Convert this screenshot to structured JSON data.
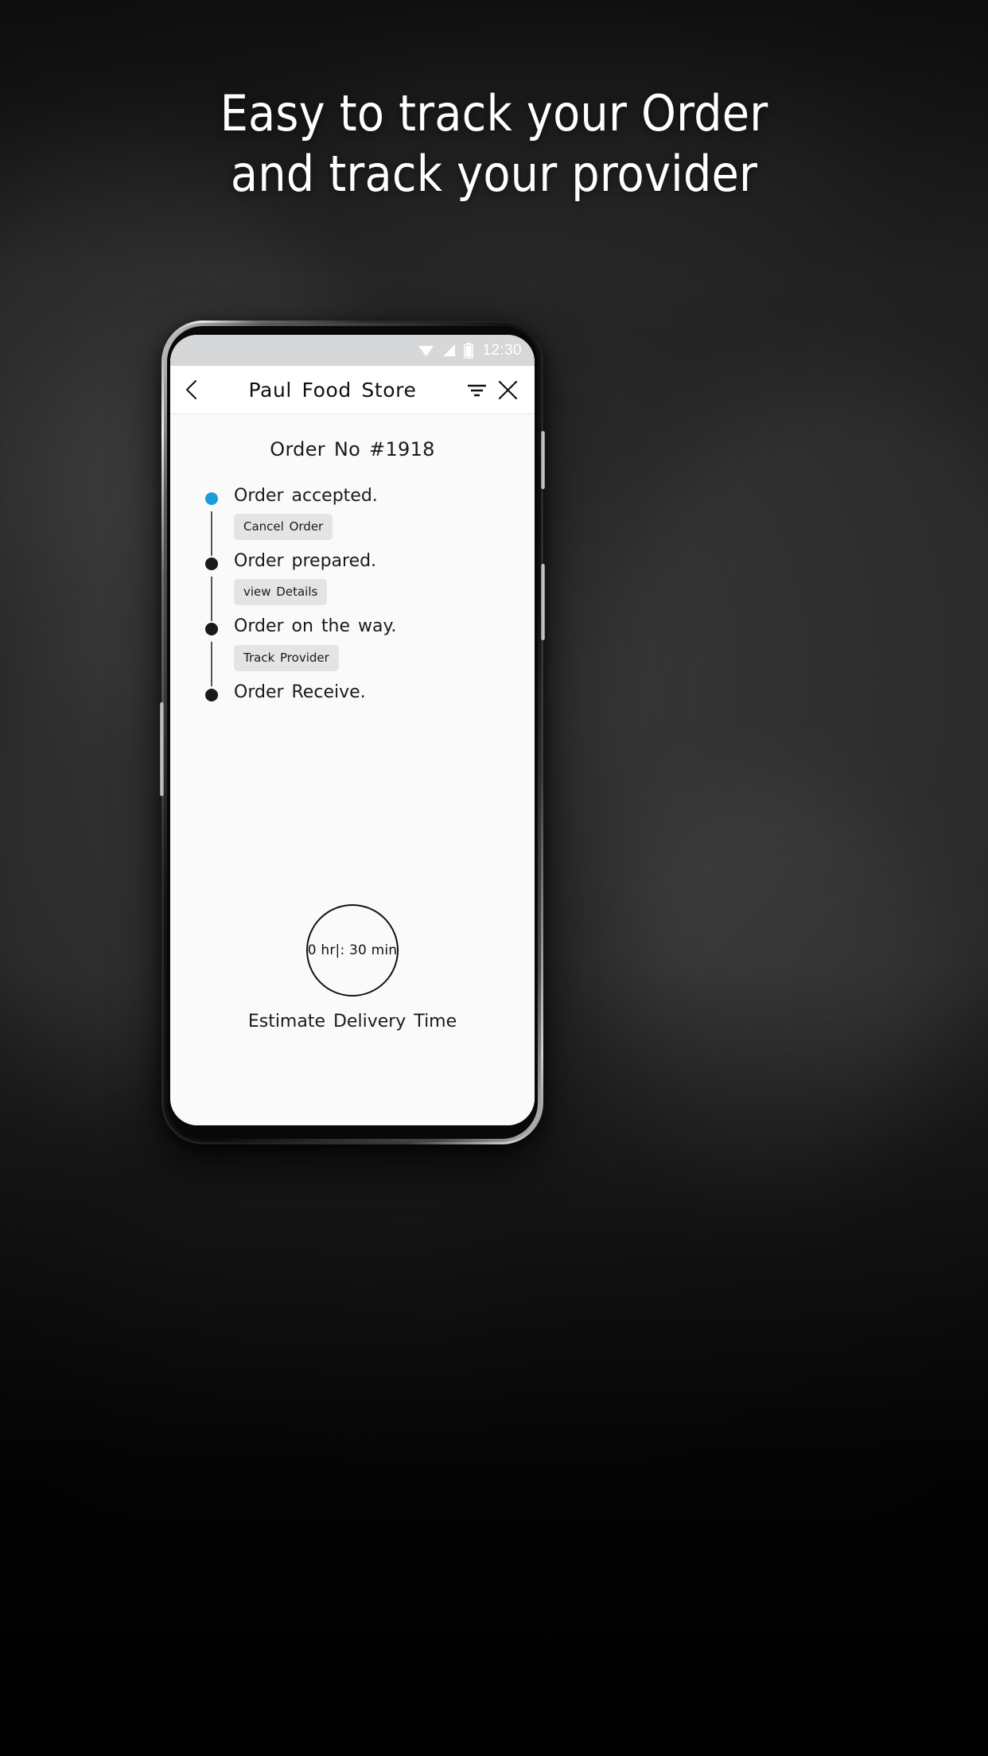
{
  "promo": {
    "headline_line1": "Easy to track your Order",
    "headline_line2": "and track your provider"
  },
  "phone": {
    "status_bar": {
      "time": "12:30",
      "icons": [
        "wifi-icon",
        "signal-icon",
        "battery-icon"
      ]
    },
    "app_bar": {
      "back_icon": "back-chevron-icon",
      "title": "Paul Food Store",
      "filter_icon": "filter-icon",
      "close_icon": "close-icon"
    },
    "screen": {
      "order_number": "Order No #1918",
      "timeline": [
        {
          "label": "Order accepted.",
          "state": "active",
          "dot_color": "#1e9cd7",
          "action": "Cancel Order"
        },
        {
          "label": "Order prepared.",
          "state": "inactive",
          "dot_color": "#1a1a1a",
          "action": "view Details"
        },
        {
          "label": "Order on the way.",
          "state": "inactive",
          "dot_color": "#1a1a1a",
          "action": "Track Provider"
        },
        {
          "label": "Order Receive.",
          "state": "inactive",
          "dot_color": "#1a1a1a",
          "action": null
        }
      ],
      "estimate": {
        "time": "0 hr|: 30 min",
        "label": "Estimate Delivery Time"
      }
    }
  },
  "colors": {
    "accent_blue": "#1e9cd7",
    "status_bar_bg": "#d6d7d9",
    "screen_bg": "#fafafa",
    "chip_bg": "#e4e4e4",
    "text_dark": "#1a1a1a",
    "backdrop": "#323232"
  }
}
